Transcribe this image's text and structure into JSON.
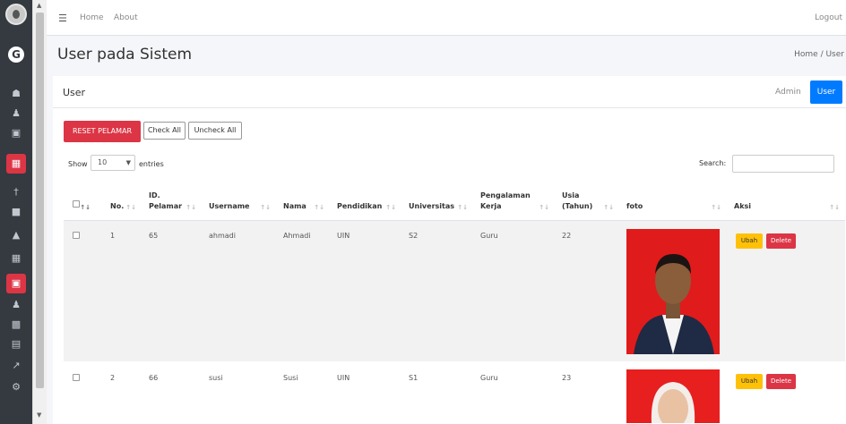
{
  "topnav": {
    "home": "Home",
    "about": "About",
    "logout": "Logout"
  },
  "header": {
    "title": "User pada Sistem",
    "breadcrumb": "Home / User"
  },
  "card": {
    "title": "User",
    "admin_link": "Admin",
    "user_button": "User"
  },
  "actions": {
    "reset": "RESET PELAMAR",
    "check_all": "Check All",
    "uncheck_all": "Uncheck All"
  },
  "length": {
    "show": "Show",
    "value": "10",
    "entries": "entries"
  },
  "search": {
    "label": "Search:"
  },
  "table": {
    "headers": [
      {
        "line1": "No."
      },
      {
        "line1": "ID.",
        "line2": "Pelamar"
      },
      {
        "line1": "Username"
      },
      {
        "line1": "Nama"
      },
      {
        "line1": "Pendidikan"
      },
      {
        "line1": "Universitas"
      },
      {
        "line1": "Pengalaman",
        "line2": "Kerja"
      },
      {
        "line1": "Usia",
        "line2": "(Tahun)"
      },
      {
        "line1": "foto"
      },
      {
        "line1": "Aksi"
      }
    ],
    "rows": [
      {
        "no": "1",
        "id": "65",
        "username": "ahmadi",
        "nama": "Ahmadi",
        "pendidikan": "UIN",
        "universitas": "S2",
        "pengalaman": "Guru",
        "usia": "22",
        "edit": "Ubah",
        "delete": "Delete"
      },
      {
        "no": "2",
        "id": "66",
        "username": "susi",
        "nama": "Susi",
        "pendidikan": "UIN",
        "universitas": "S1",
        "pengalaman": "Guru",
        "usia": "23",
        "edit": "Ubah",
        "delete": "Delete"
      }
    ]
  },
  "sidebar": {
    "icons": [
      "logo-icon",
      "brand-icon",
      "home-icon",
      "user-icon",
      "image-icon",
      "calculator-icon",
      "person-icon",
      "calendar-icon",
      "bank-icon",
      "table-icon",
      "briefcase-icon",
      "user-icon",
      "chart-bar-icon",
      "calculator-icon",
      "chart-line-icon",
      "cogs-icon"
    ]
  },
  "colors": {
    "accent": "#007bff",
    "danger": "#dc3545",
    "warning": "#ffc107",
    "sidebar": "#343a40"
  }
}
